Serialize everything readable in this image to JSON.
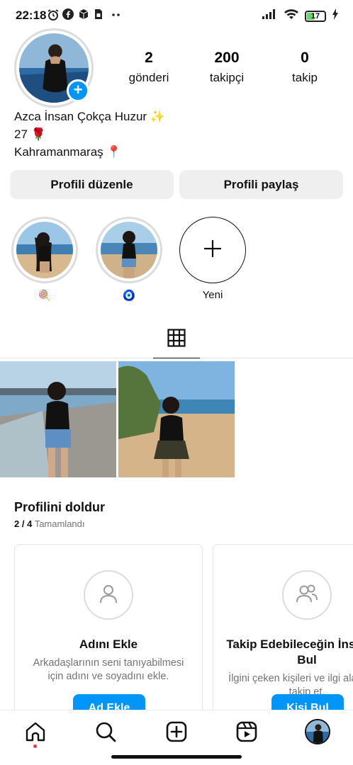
{
  "status_bar": {
    "time": "22:18",
    "battery": "17"
  },
  "profile": {
    "stats": [
      {
        "value": "2",
        "label": "gönderi"
      },
      {
        "value": "200",
        "label": "takipçi"
      },
      {
        "value": "0",
        "label": "takip"
      }
    ],
    "bio_lines": [
      "Azca İnsan Çokça Huzur ✨",
      "27 🌹",
      "Kahramanmaraş 📍"
    ]
  },
  "buttons": {
    "edit_profile": "Profili düzenle",
    "share_profile": "Profili paylaş"
  },
  "highlights": [
    {
      "caption": "🍭"
    },
    {
      "caption": "🧿"
    },
    {
      "caption": "Yeni"
    }
  ],
  "complete_profile": {
    "title": "Profilini doldur",
    "progress": "2 / 4",
    "progress_label": "Tamamlandı",
    "cards": [
      {
        "title": "Adını Ekle",
        "description": "Arkadaşlarının seni tanıyabilmesi için adını ve soyadını ekle.",
        "button": "Ad Ekle",
        "icon": "person-icon"
      },
      {
        "title": "Takip Edebileceğin İnsanları Bul",
        "description": "İlgini çeken kişileri ve ilgi alanlarını takip et.",
        "button": "Kişi Bul",
        "icon": "people-icon"
      }
    ]
  },
  "nav": [
    "home-icon",
    "search-icon",
    "create-icon",
    "reels-icon",
    "profile-avatar"
  ],
  "colors": {
    "accent": "#0095f6",
    "button_bg": "#efefef",
    "notification_dot": "#ff3040"
  }
}
